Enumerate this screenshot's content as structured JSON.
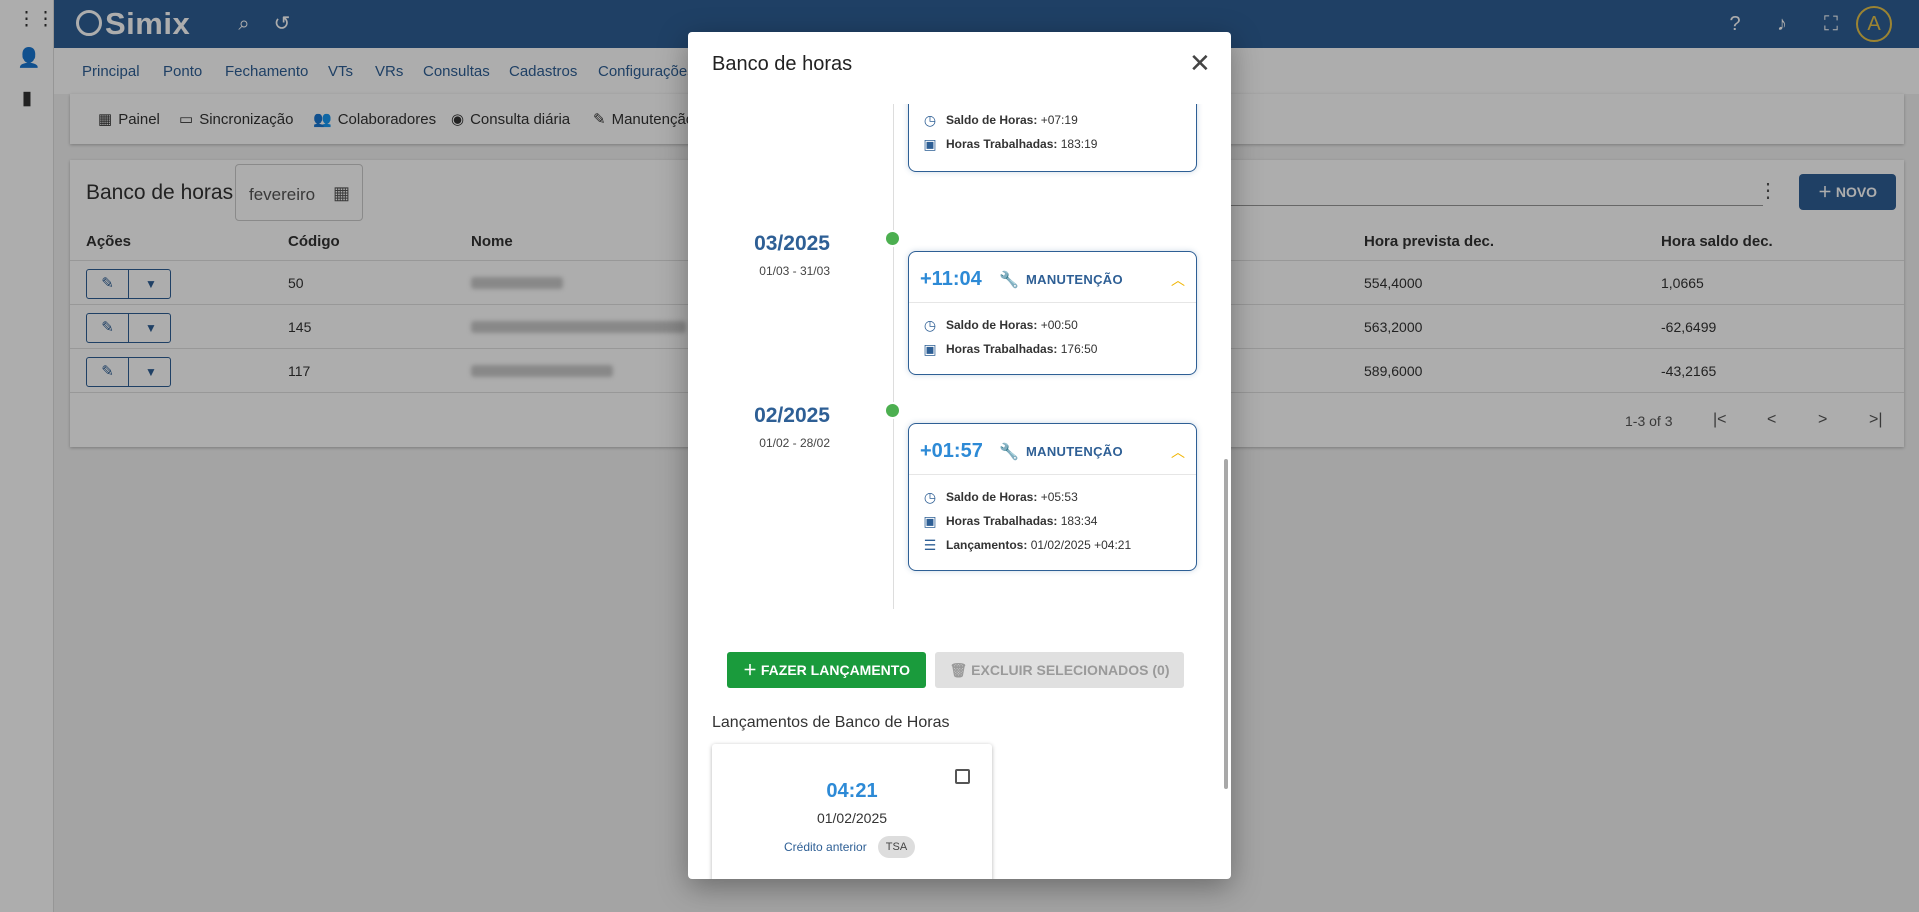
{
  "app": {
    "logo": "Simix"
  },
  "menu": [
    "Principal",
    "Ponto",
    "Fechamento",
    "VTs",
    "VRs",
    "Consultas",
    "Cadastros",
    "Configurações"
  ],
  "submenu": [
    {
      "icon": "dashboard-icon",
      "label": "Painel"
    },
    {
      "icon": "sync-icon",
      "label": "Sincronização"
    },
    {
      "icon": "people-icon",
      "label": "Colaboradores"
    },
    {
      "icon": "eye-icon",
      "label": "Consulta diária"
    },
    {
      "icon": "pencil-icon",
      "label": "Manutenção"
    }
  ],
  "page": {
    "title": "Banco de horas",
    "month_value": "fevereiro",
    "new_button": "NOVO",
    "columns": [
      "Ações",
      "Código",
      "Nome",
      "Hora prevista dec.",
      "Hora saldo dec."
    ],
    "rows": [
      {
        "codigo": "50",
        "prevista": "554,4000",
        "saldo": "1,0665"
      },
      {
        "codigo": "145",
        "prevista": "563,2000",
        "saldo": "-62,6499"
      },
      {
        "codigo": "117",
        "prevista": "589,6000",
        "saldo": "-43,2165"
      }
    ],
    "pagination": "1-3 of 3"
  },
  "modal": {
    "title": "Banco de horas",
    "top_card": {
      "saldo_label": "Saldo de Horas:",
      "saldo": "+07:19",
      "trab_label": "Horas Trabalhadas:",
      "trab": "183:19"
    },
    "entries": [
      {
        "month": "03/2025",
        "range": "01/03 - 31/03",
        "value": "+11:04",
        "tag": "MANUTENÇÃO",
        "saldo_label": "Saldo de Horas:",
        "saldo": "+00:50",
        "trab_label": "Horas Trabalhadas:",
        "trab": "176:50"
      },
      {
        "month": "02/2025",
        "range": "01/02 - 28/02",
        "value": "+01:57",
        "tag": "MANUTENÇÃO",
        "saldo_label": "Saldo de Horas:",
        "saldo": "+05:53",
        "trab_label": "Horas Trabalhadas:",
        "trab": "183:34",
        "lanc_label": "Lançamentos:",
        "lanc": "01/02/2025 +04:21"
      }
    ],
    "btn_lancamento": "FAZER LANÇAMENTO",
    "btn_excluir": "EXCLUIR SELECIONADOS (0)",
    "lancamentos_title": "Lançamentos de Banco de Horas",
    "lancamento": {
      "hours": "04:21",
      "date": "01/02/2025",
      "type": "Crédito anterior",
      "badge": "TSA"
    }
  },
  "colors": {
    "primary": "#2e5f95",
    "accent_blue": "#2d8ad6",
    "green": "#1a9b3c",
    "warning": "#f0b400"
  }
}
